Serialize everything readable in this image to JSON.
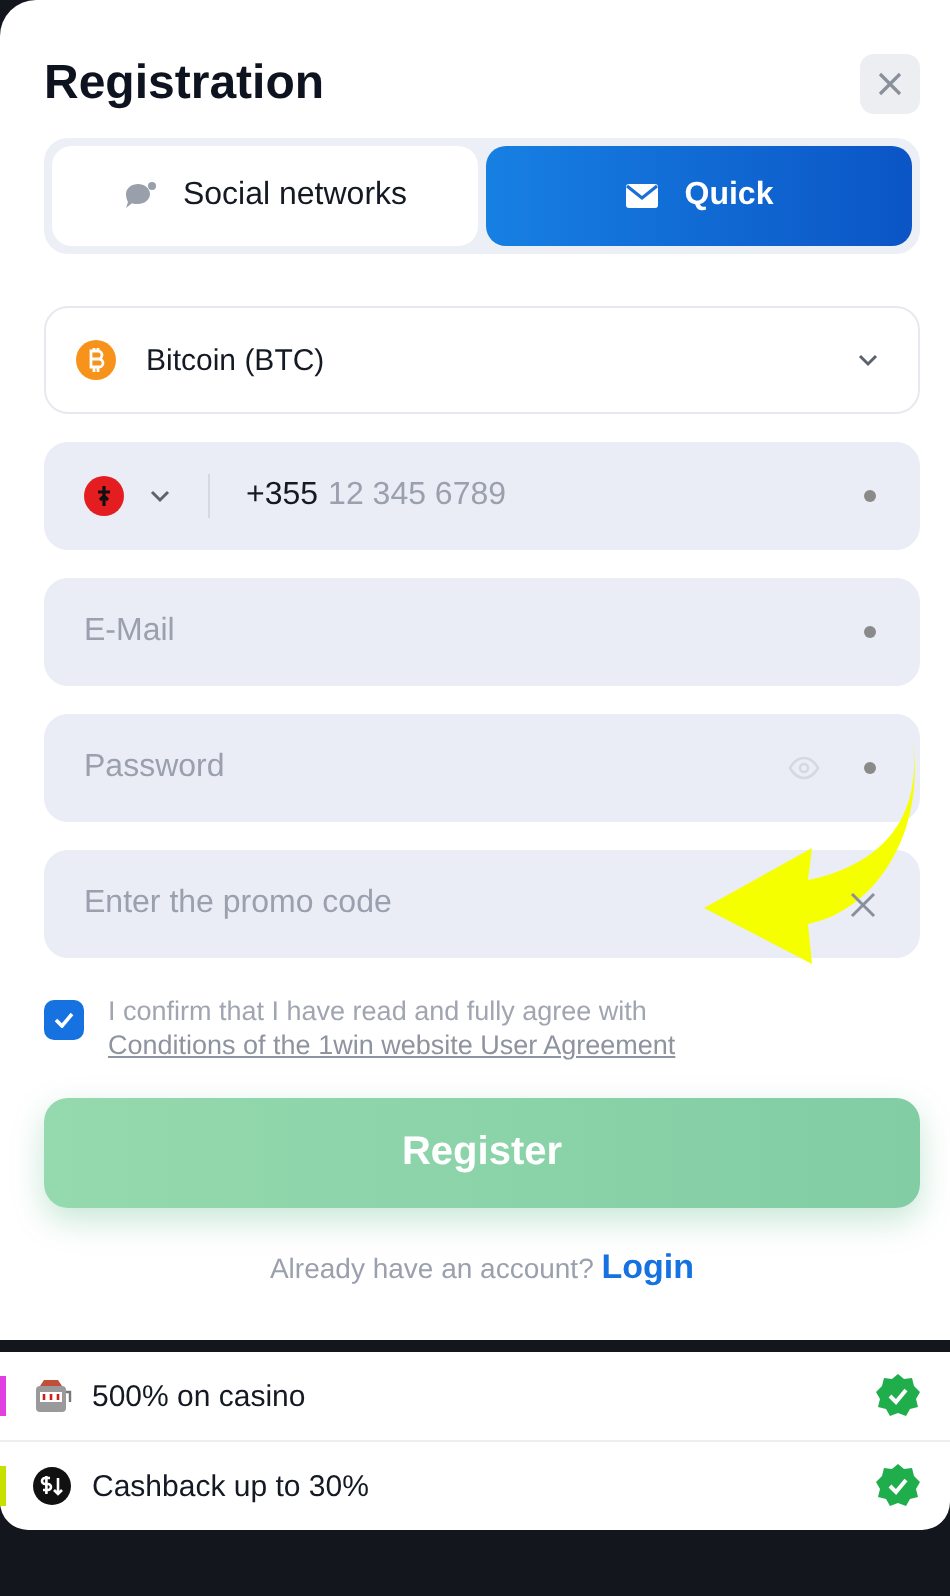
{
  "title": "Registration",
  "tabs": [
    {
      "label": "Social networks",
      "kind": "social",
      "selected": false
    },
    {
      "label": "Quick",
      "kind": "mail",
      "selected": true
    }
  ],
  "currency": {
    "value": "Bitcoin (BTC)"
  },
  "phone": {
    "code": "+355",
    "placeholder": "12 345 6789",
    "required": true
  },
  "fields": [
    {
      "kind": "email",
      "placeholder": "E-Mail",
      "required": true
    },
    {
      "kind": "password",
      "placeholder": "Password",
      "required": true
    },
    {
      "kind": "promo",
      "placeholder": "Enter the promo code",
      "required": false
    }
  ],
  "agreement": {
    "checked": true,
    "text": "I confirm that I have read and fully agree with",
    "link": "Conditions of the 1win website User Agreement"
  },
  "register_button": {
    "label": "Register",
    "disabled": true
  },
  "login_prompt": {
    "text": "Already have an account?",
    "link": "Login"
  },
  "bonuses": [
    {
      "kind": "slot",
      "label": "500% on casino",
      "color": "#e040e0",
      "checked": true
    },
    {
      "kind": "cashback",
      "label": "Cashback up to 30%",
      "color": "#c8e000",
      "checked": true
    }
  ]
}
